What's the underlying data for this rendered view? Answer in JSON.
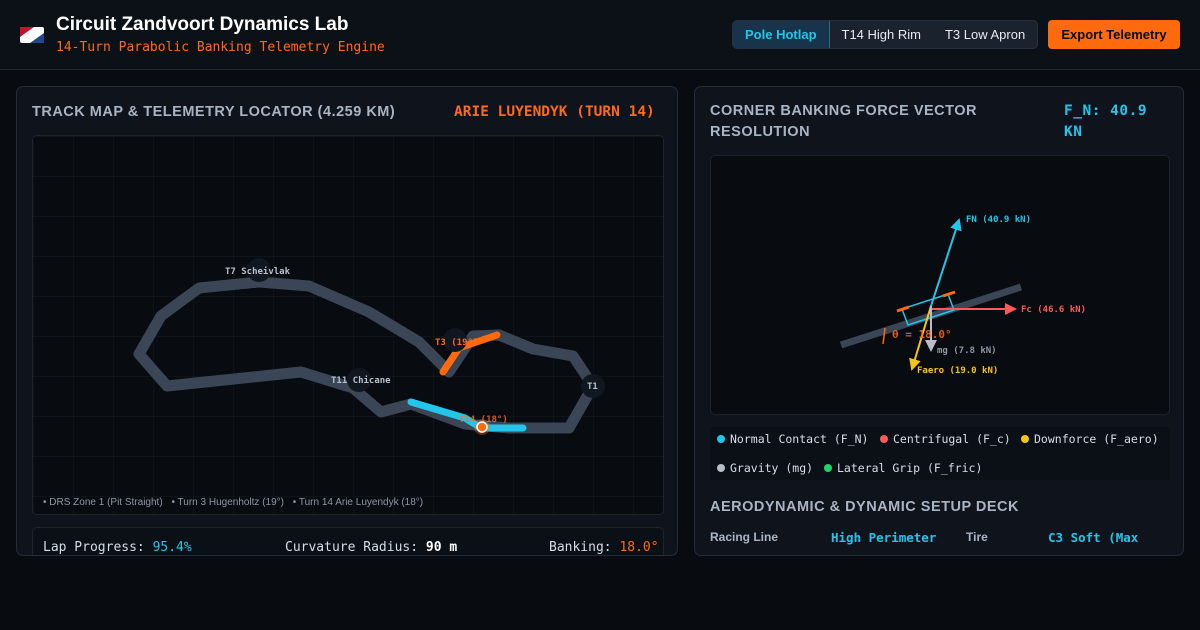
{
  "header": {
    "title": "Circuit Zandvoort Dynamics Lab",
    "subtitle": "14-Turn Parabolic Banking Telemetry Engine",
    "modes": [
      "Pole Hotlap",
      "T14 High Rim",
      "T3 Low Apron"
    ],
    "active_mode": "Pole Hotlap",
    "export_label": "Export Telemetry"
  },
  "track_panel": {
    "title": "TRACK MAP & TELEMETRY LOCATOR (4.259 KM)",
    "active_corner": "ARIE LUYENDYK (TURN 14)",
    "labels": {
      "t7": "T7 Scheivlak",
      "t3": "T3 (19°)",
      "t11": "T11 Chicane",
      "t1": "T1",
      "t14": "T14 (18°)"
    },
    "legend": [
      "• DRS Zone 1 (Pit Straight)",
      "• Turn 3 Hugenholtz (19°)",
      "• Turn 14 Arie Luyendyk (18°)"
    ],
    "stats": {
      "lap_label": "Lap Progress:",
      "lap_value": "95.4%",
      "radius_label": "Curvature Radius:",
      "radius_value": "90 m",
      "banking_label": "Banking:",
      "banking_value": "18.0°"
    },
    "colors": {
      "track": "#3a4656",
      "drs_highlight": "#23c6ea",
      "t3_highlight": "#ff6a0d",
      "car_marker": "#ff6a0d"
    }
  },
  "vector_panel": {
    "title": "CORNER BANKING FORCE VECTOR RESOLUTION",
    "fn_readout": "F_N: 40.9 KN",
    "vector_labels": {
      "fn": "FN (40.9 kN)",
      "fc": "Fc (46.6 kN)",
      "theta": "θ = 18.0°",
      "mg": "mg (7.8 kN)",
      "faero": "Faero (19.0 kN)"
    },
    "legend": [
      {
        "label": "Normal Contact (F_N)",
        "color": "#23c6ea"
      },
      {
        "label": "Centrifugal (F_c)",
        "color": "#ff5a5a"
      },
      {
        "label": "Downforce (F_aero)",
        "color": "#f5c518"
      },
      {
        "label": "Gravity (mg)",
        "color": "#b8bec8"
      },
      {
        "label": "Lateral Grip (F_fric)",
        "color": "#22d36a"
      }
    ],
    "deck_title": "AERODYNAMIC & DYNAMIC SETUP DECK",
    "deck": {
      "racing_line_label": "Racing Line",
      "racing_line_value": "High Perimeter",
      "tire_label": "Tire",
      "tire_value": "C3 Soft (Max"
    }
  }
}
